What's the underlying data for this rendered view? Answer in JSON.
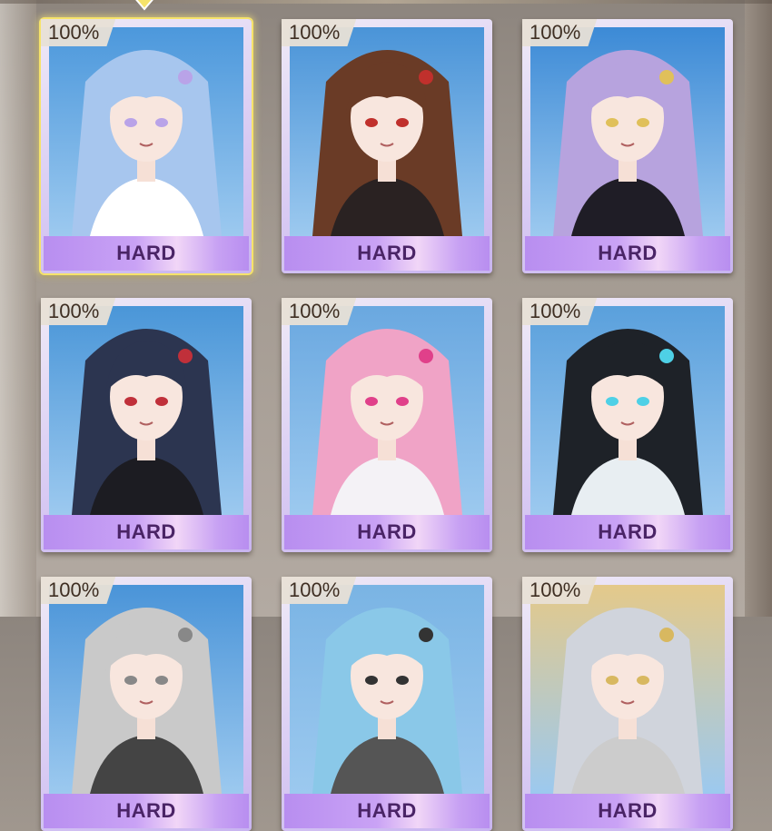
{
  "cards": [
    {
      "progress": "100%",
      "difficulty": "HARD",
      "selected": true,
      "hair": "#a7c6ee",
      "accent": "#b9a3e8",
      "outfit": "#ffffff",
      "bg": "#4c98dc"
    },
    {
      "progress": "100%",
      "difficulty": "HARD",
      "selected": false,
      "hair": "#6a3b26",
      "accent": "#c0302c",
      "outfit": "#2a2222",
      "bg": "#4a94d8"
    },
    {
      "progress": "100%",
      "difficulty": "HARD",
      "selected": false,
      "hair": "#b7a3de",
      "accent": "#e0c05a",
      "outfit": "#1f1d26",
      "bg": "#3c8ad6"
    },
    {
      "progress": "100%",
      "difficulty": "HARD",
      "selected": false,
      "hair": "#2c3550",
      "accent": "#c0303a",
      "outfit": "#1c1c22",
      "bg": "#4a96d8"
    },
    {
      "progress": "100%",
      "difficulty": "HARD",
      "selected": false,
      "hair": "#f0a3c6",
      "accent": "#e0408a",
      "outfit": "#f4f2f6",
      "bg": "#6aa8e0"
    },
    {
      "progress": "100%",
      "difficulty": "HARD",
      "selected": false,
      "hair": "#1e2228",
      "accent": "#4ed0e6",
      "outfit": "#e8eef2",
      "bg": "#5aa0dc"
    },
    {
      "progress": "100%",
      "difficulty": "HARD",
      "selected": false,
      "hair": "#c9c9c9",
      "accent": "#888888",
      "outfit": "#444444",
      "bg": "#4a94d8"
    },
    {
      "progress": "100%",
      "difficulty": "HARD",
      "selected": false,
      "hair": "#8ac8e8",
      "accent": "#333333",
      "outfit": "#555555",
      "bg": "#7ab4e4"
    },
    {
      "progress": "100%",
      "difficulty": "HARD",
      "selected": false,
      "hair": "#d0d4dc",
      "accent": "#d8b860",
      "outfit": "#ccc",
      "bg": "#e4c98a"
    }
  ]
}
